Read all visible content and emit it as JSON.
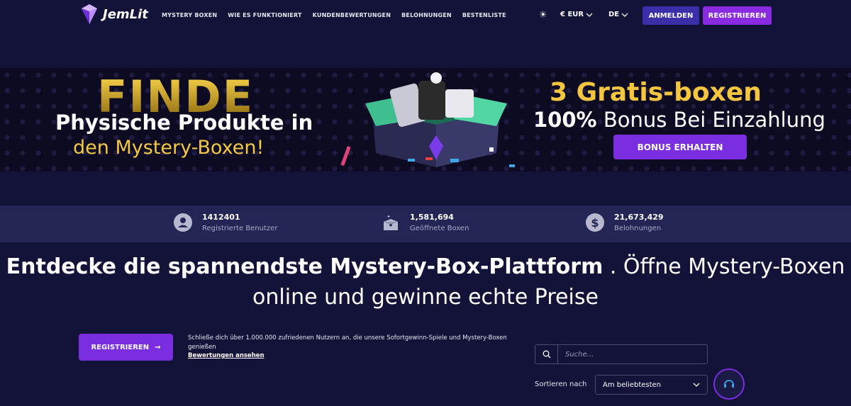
{
  "header": {
    "brand": "JemLit",
    "nav": [
      "MYSTERY BOXEN",
      "WIE ES FUNKTIONIERT",
      "KUNDENBEWERTUNGEN",
      "BELOHNUNGEN",
      "BESTENLISTE"
    ],
    "currency": "€ EUR",
    "language": "DE",
    "login_label": "ANMELDEN",
    "register_label": "REGISTRIEREN"
  },
  "banner": {
    "finde": "FINDE",
    "line1": "Physische Produkte in",
    "line2": "den Mystery-Boxen!",
    "gratis": "3 Gratis-boxen",
    "bonus_strong": "100%",
    "bonus_rest": "Bonus Bei Einzahlung",
    "button": "BONUS ERHALTEN"
  },
  "stats": [
    {
      "value": "1412401",
      "label": "Registrierte Benutzer",
      "icon": "user-icon"
    },
    {
      "value": "1,581,694",
      "label": "Geöffnete Boxen",
      "icon": "box-icon"
    },
    {
      "value": "21,673,429",
      "label": "Belohnungen",
      "icon": "dollar-icon"
    }
  ],
  "headline": {
    "bold": "Entdecke die spannendste Mystery-Box-Plattform",
    "rest1": " . Öffne Mystery-Boxen",
    "rest2": "online und gewinne echte Preise"
  },
  "cta": {
    "button": "REGISTRIEREN",
    "text": "Schließe dich über 1.000.000 zufriedenen Nutzern an, die unsere Sofortgewinn-Spiele und Mystery-Boxen genießen",
    "link": "Bewertungen ansehen"
  },
  "search": {
    "placeholder": "Suche..."
  },
  "sort": {
    "label": "Sortieren nach",
    "value": "Am beliebtesten"
  },
  "colors": {
    "background": "#131238",
    "accent": "#7a2ee0",
    "gold": "#f4c63f"
  }
}
